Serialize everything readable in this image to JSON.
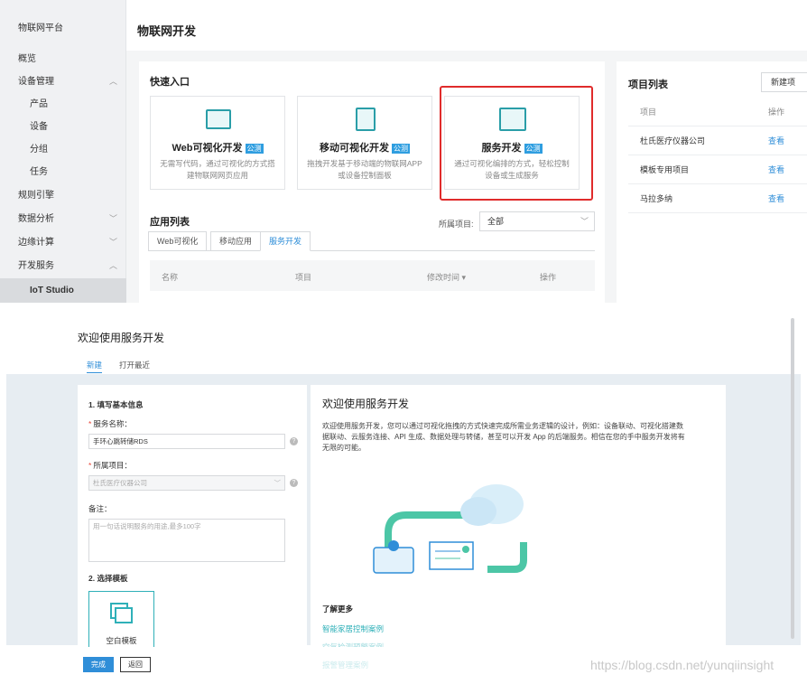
{
  "sidebar": {
    "items": [
      {
        "label": "物联网平台"
      },
      {
        "label": "概览"
      },
      {
        "label": "设备管理"
      },
      {
        "label": "产品"
      },
      {
        "label": "设备"
      },
      {
        "label": "分组"
      },
      {
        "label": "任务"
      },
      {
        "label": "规则引擎"
      },
      {
        "label": "数据分析"
      },
      {
        "label": "边缘计算"
      },
      {
        "label": "开发服务"
      },
      {
        "label": "IoT Studio"
      }
    ]
  },
  "header": {
    "title": "物联网开发"
  },
  "quick_entry": {
    "title": "快速入口",
    "badge": "公测",
    "cards": [
      {
        "title": "Web可视化开发",
        "desc": "无需写代码，通过可视化的方式搭建物联网网页应用"
      },
      {
        "title": "移动可视化开发",
        "desc": "拖拽开发基于移动端的物联网APP或设备控制面板"
      },
      {
        "title": "服务开发",
        "desc": "通过可视化编排的方式，轻松控制设备或生成服务"
      }
    ]
  },
  "app_list": {
    "title": "应用列表",
    "project_label": "所属项目:",
    "project_value": "全部",
    "tabs": [
      "Web可视化",
      "移动应用",
      "服务开发"
    ],
    "columns": [
      "名称",
      "项目",
      "修改时间 ▾",
      "操作"
    ]
  },
  "project_list": {
    "title": "项目列表",
    "new_button": "新建项",
    "columns": [
      "项目",
      "操作"
    ],
    "rows": [
      {
        "name": "杜氏医疗仪器公司",
        "action": "查看"
      },
      {
        "name": "模板专用项目",
        "action": "查看"
      },
      {
        "name": "马拉多纳",
        "action": "查看"
      }
    ]
  },
  "dialog": {
    "title": "欢迎使用服务开发",
    "tabs": [
      "新建",
      "打开最近"
    ],
    "form": {
      "section1": "1. 填写基本信息",
      "name_label": "服务名称：",
      "name_value": "手环心跳转储RDS",
      "project_label": "所属项目：",
      "project_value": "杜氏医疗仪器公司",
      "note_label": "备注：",
      "note_placeholder": "用一句话说明服务的用途,最多100字",
      "section2": "2. 选择模板",
      "template_label": "空白模板"
    },
    "welcome": {
      "title": "欢迎使用服务开发",
      "body": "欢迎使用服务开发，您可以通过可视化拖拽的方式快速完成所需业务逻辑的设计，例如：设备联动、可视化搭建数据联动、云服务连接、API 生成、数据处理与转储，甚至可以开发 App 的后端服务。相信在您的手中服务开发将有无限的可能。",
      "learn_more": "了解更多",
      "links": [
        "智能家居控制案例",
        "空气检测预警案例",
        "报警管理案例"
      ]
    },
    "buttons": {
      "done": "完成",
      "back": "返回"
    }
  },
  "watermark": "https://blog.csdn.net/yunqiinsight",
  "colors": {
    "accent": "#2f8ed8",
    "teal": "#2fb0b8",
    "highlight": "#e02b2b"
  }
}
